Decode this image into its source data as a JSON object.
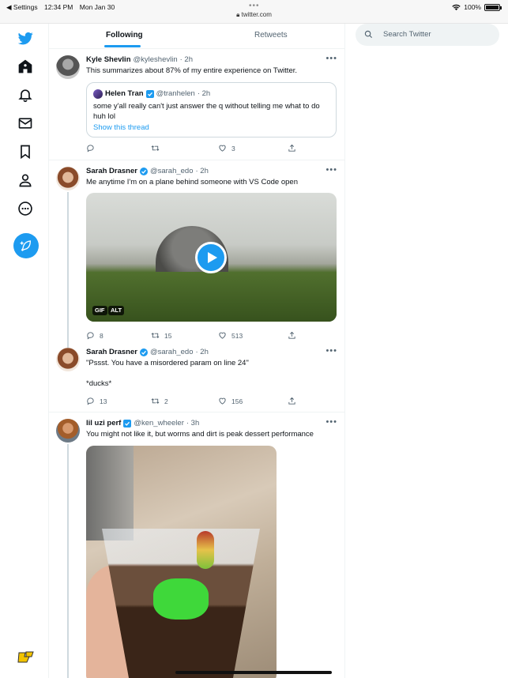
{
  "status_bar": {
    "back_label": "◀ Settings",
    "time": "12:34 PM",
    "date": "Mon Jan 30",
    "url": "twitter.com",
    "battery": "100%"
  },
  "tabs": [
    {
      "label": "Following"
    },
    {
      "label": "Retweets"
    }
  ],
  "search": {
    "placeholder": "Search Twitter"
  },
  "tweets": [
    {
      "name": "Kyle Shevlin",
      "handle": "@kyleshevlin",
      "time": "· 2h",
      "text": "This summarizes about 87% of my entire experience on Twitter.",
      "quote": {
        "name": "Helen Tran",
        "handle": "@tranhelen",
        "time": "· 2h",
        "text": "some y'all really can't just answer the q without telling me what to do huh lol",
        "link": "Show this thread"
      },
      "replies": "",
      "retweets": "",
      "likes": "3"
    },
    {
      "name": "Sarah Drasner",
      "handle": "@sarah_edo",
      "time": "· 2h",
      "text": "Me anytime I'm on a plane behind someone with VS Code open",
      "media_badges": [
        "GIF",
        "ALT"
      ],
      "replies": "8",
      "retweets": "15",
      "likes": "513"
    },
    {
      "name": "Sarah Drasner",
      "handle": "@sarah_edo",
      "time": "· 2h",
      "text": "\"Pssst. You have a misordered param on line 24\"\n\n*ducks*",
      "replies": "13",
      "retweets": "2",
      "likes": "156"
    },
    {
      "name": "lil uzi perf",
      "handle": "@ken_wheeler",
      "time": "· 3h",
      "text": "You might not like it, but worms and dirt is peak dessert performance"
    }
  ],
  "colors": {
    "accent": "#1d9bf0",
    "text": "#0f1419",
    "muted": "#536471",
    "border": "#eff3f4"
  },
  "icons": [
    "twitter-bird-icon",
    "home-icon",
    "bell-icon",
    "mail-icon",
    "bookmark-icon",
    "profile-icon",
    "more-circle-icon",
    "compose-icon",
    "search-icon"
  ]
}
